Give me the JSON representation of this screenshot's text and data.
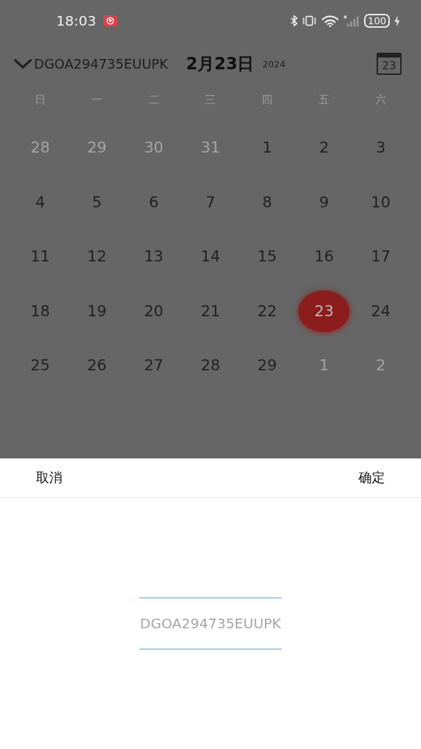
{
  "status_bar": {
    "time": "18:03",
    "battery": "100"
  },
  "header": {
    "device": "DGOA294735EUUPK",
    "date": "2月23日",
    "year": "2024",
    "today_icon": "23"
  },
  "weekdays": [
    "日",
    "一",
    "二",
    "三",
    "四",
    "五",
    "六"
  ],
  "days": [
    {
      "label": "28",
      "in_month": false,
      "selected": false
    },
    {
      "label": "29",
      "in_month": false,
      "selected": false
    },
    {
      "label": "30",
      "in_month": false,
      "selected": false
    },
    {
      "label": "31",
      "in_month": false,
      "selected": false
    },
    {
      "label": "1",
      "in_month": true,
      "selected": false
    },
    {
      "label": "2",
      "in_month": true,
      "selected": false
    },
    {
      "label": "3",
      "in_month": true,
      "selected": false
    },
    {
      "label": "4",
      "in_month": true,
      "selected": false
    },
    {
      "label": "5",
      "in_month": true,
      "selected": false
    },
    {
      "label": "6",
      "in_month": true,
      "selected": false
    },
    {
      "label": "7",
      "in_month": true,
      "selected": false
    },
    {
      "label": "8",
      "in_month": true,
      "selected": false
    },
    {
      "label": "9",
      "in_month": true,
      "selected": false
    },
    {
      "label": "10",
      "in_month": true,
      "selected": false
    },
    {
      "label": "11",
      "in_month": true,
      "selected": false
    },
    {
      "label": "12",
      "in_month": true,
      "selected": false
    },
    {
      "label": "13",
      "in_month": true,
      "selected": false
    },
    {
      "label": "14",
      "in_month": true,
      "selected": false
    },
    {
      "label": "15",
      "in_month": true,
      "selected": false
    },
    {
      "label": "16",
      "in_month": true,
      "selected": false
    },
    {
      "label": "17",
      "in_month": true,
      "selected": false
    },
    {
      "label": "18",
      "in_month": true,
      "selected": false
    },
    {
      "label": "19",
      "in_month": true,
      "selected": false
    },
    {
      "label": "20",
      "in_month": true,
      "selected": false
    },
    {
      "label": "21",
      "in_month": true,
      "selected": false
    },
    {
      "label": "22",
      "in_month": true,
      "selected": false
    },
    {
      "label": "23",
      "in_month": true,
      "selected": true
    },
    {
      "label": "24",
      "in_month": true,
      "selected": false
    },
    {
      "label": "25",
      "in_month": true,
      "selected": false
    },
    {
      "label": "26",
      "in_month": true,
      "selected": false
    },
    {
      "label": "27",
      "in_month": true,
      "selected": false
    },
    {
      "label": "28",
      "in_month": true,
      "selected": false
    },
    {
      "label": "29",
      "in_month": true,
      "selected": false
    },
    {
      "label": "1",
      "in_month": false,
      "selected": false
    },
    {
      "label": "2",
      "in_month": false,
      "selected": false
    }
  ],
  "sheet": {
    "cancel": "取消",
    "confirm": "确定",
    "options": [
      {
        "label": "DGOA294735EUUPK",
        "selected": true
      }
    ]
  }
}
